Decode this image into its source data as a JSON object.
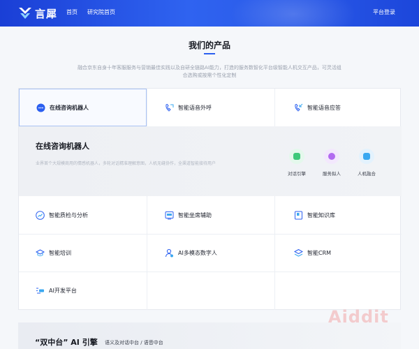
{
  "header": {
    "logo_text": "言犀",
    "nav": [
      "首页",
      "研究院首页"
    ],
    "login_label": "平台登录"
  },
  "section": {
    "title": "我们的产品",
    "description": "融合京东自身十年客服服务与营销最佳实践以及自研全链路AI能力，打造的服务数智化平台级智能人机交互产品，可灵活组合选购或按需个性化定制"
  },
  "tabs": [
    {
      "label": "在线咨询机器人",
      "icon": "chat-bubble-icon",
      "active": true
    },
    {
      "label": "智能语音外呼",
      "icon": "phone-outgoing-icon",
      "active": false
    },
    {
      "label": "智能语音应答",
      "icon": "phone-incoming-icon",
      "active": false
    }
  ],
  "detail": {
    "title": "在线咨询机器人",
    "description": "业界首个大规模商用的情感机器人，多轮对话精准理解意图，人机无缝协作，全渠道智能接待用户",
    "features": [
      {
        "label": "对话引擎",
        "icon": "dialogue-engine-icon",
        "color": "#3ec97a"
      },
      {
        "label": "服务拟人",
        "icon": "service-persona-icon",
        "color": "#b26af0"
      },
      {
        "label": "人机融合",
        "icon": "human-machine-icon",
        "color": "#3aa8f0"
      }
    ]
  },
  "products": [
    {
      "label": "智能质检与分析",
      "icon": "quality-analysis-icon"
    },
    {
      "label": "智能坐席辅助",
      "icon": "agent-assist-icon"
    },
    {
      "label": "智能知识库",
      "icon": "knowledge-base-icon"
    },
    {
      "label": "智能培训",
      "icon": "training-icon"
    },
    {
      "label": "AI多模态数字人",
      "icon": "digital-human-icon"
    },
    {
      "label": "智能CRM",
      "icon": "crm-icon"
    },
    {
      "label": "AI开发平台",
      "icon": "dev-platform-icon"
    }
  ],
  "bottom": {
    "title": "“双中台” AI 引擎",
    "subtitle": "语义及对话中台 / 语音中台"
  },
  "watermark": "Aiddit"
}
